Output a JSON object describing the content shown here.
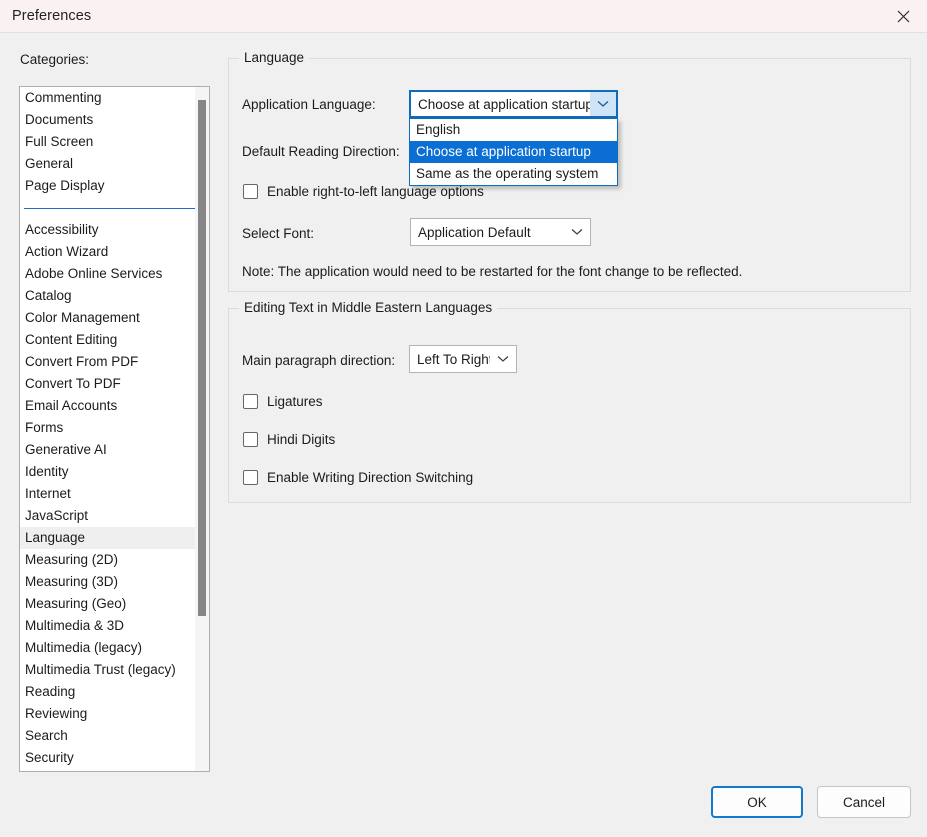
{
  "window": {
    "title": "Preferences",
    "close_icon": "close-icon"
  },
  "sidebar": {
    "label": "Categories:",
    "items_top": [
      "Commenting",
      "Documents",
      "Full Screen",
      "General",
      "Page Display"
    ],
    "items_bottom": [
      "Accessibility",
      "Action Wizard",
      "Adobe Online Services",
      "Catalog",
      "Color Management",
      "Content Editing",
      "Convert From PDF",
      "Convert To PDF",
      "Email Accounts",
      "Forms",
      "Generative AI",
      "Identity",
      "Internet",
      "JavaScript",
      "Language",
      "Measuring (2D)",
      "Measuring (3D)",
      "Measuring (Geo)",
      "Multimedia & 3D",
      "Multimedia (legacy)",
      "Multimedia Trust (legacy)",
      "Reading",
      "Reviewing",
      "Search",
      "Security"
    ],
    "selected": "Language"
  },
  "language_group": {
    "title": "Language",
    "application_language_label": "Application Language:",
    "application_language_value": "Choose at application startup",
    "default_reading_direction_label": "Default Reading Direction:",
    "rtl_checkbox_label": "Enable right-to-left language options",
    "rtl_checked": false,
    "select_font_label": "Select Font:",
    "select_font_value": "Application Default",
    "note": "Note: The application would need to be restarted for the font change to be reflected."
  },
  "dropdown": {
    "open": true,
    "options": [
      "English",
      "Choose at application startup",
      "Same as the operating system"
    ],
    "highlighted_index": 1
  },
  "middle_eastern_group": {
    "title": "Editing Text in Middle Eastern Languages",
    "paragraph_direction_label": "Main paragraph direction:",
    "paragraph_direction_value": "Left To Right",
    "checkboxes": [
      {
        "label": "Ligatures",
        "checked": false
      },
      {
        "label": "Hindi Digits",
        "checked": false
      },
      {
        "label": "Enable Writing Direction Switching",
        "checked": false
      }
    ]
  },
  "footer": {
    "ok_label": "OK",
    "cancel_label": "Cancel"
  },
  "colors": {
    "accent": "#0b6ed2",
    "focus_border": "#0f6cbd",
    "separator": "#1f6fc4",
    "titlebar_bg": "#faf2f2",
    "dialog_bg": "#f0f0f0"
  }
}
